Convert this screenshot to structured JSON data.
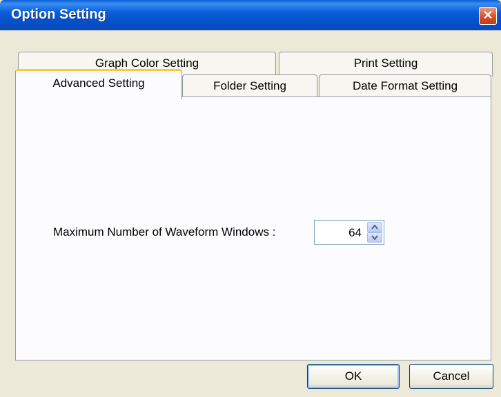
{
  "window": {
    "title": "Option Setting",
    "close_glyph": "✕"
  },
  "tabs": {
    "row1": [
      {
        "label": "Graph Color Setting"
      },
      {
        "label": "Print Setting"
      }
    ],
    "row2": [
      {
        "label": "Advanced Setting",
        "active": true
      },
      {
        "label": "Folder Setting"
      },
      {
        "label": "Date Format Setting"
      }
    ]
  },
  "advanced": {
    "max_windows_label": "Maximum Number of Waveform Windows :",
    "max_windows_value": "64"
  },
  "buttons": {
    "ok": "OK",
    "cancel": "Cancel"
  },
  "icons": {
    "spin_up": "arrow-up-icon",
    "spin_down": "arrow-down-icon",
    "close": "close-icon"
  },
  "colors": {
    "titlebar": "#0a5fd6",
    "active_tab_accent": "#ffc83c",
    "dialog_bg": "#ece9d8"
  }
}
